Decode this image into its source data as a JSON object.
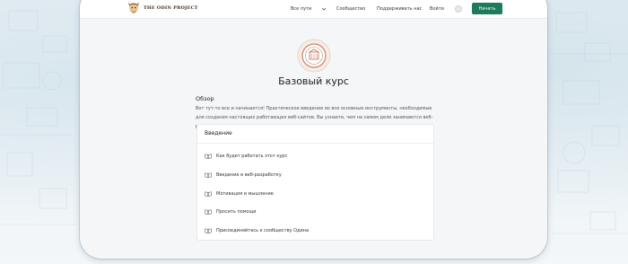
{
  "brand": {
    "name": "THE ODIN PROJECT"
  },
  "nav": {
    "items": [
      {
        "id": "paths",
        "label": "Все пути"
      },
      {
        "id": "community",
        "label": "Сообщество"
      },
      {
        "id": "support",
        "label": "Поддерживать нас"
      },
      {
        "id": "login",
        "label": "Войти"
      }
    ],
    "start_label": "Начать"
  },
  "course": {
    "title": "Базовый курс",
    "badge_icon": "foundations-badge-icon",
    "overview_heading": "Обзор",
    "overview_text": "Вот тут-то все и начинается! Практическое введение во все основные инструменты, необходимые для создания настоящих работающих веб-сайтов. Вы узнаете, чем на самом деле занимаются веб-разработчики – основы, которые вам понадобятся для последующих курсов."
  },
  "lessons": {
    "section_title": "Введение",
    "items": [
      {
        "label": "Как будет работать этот курс"
      },
      {
        "label": "Введение в веб-разработку"
      },
      {
        "label": "Мотивация и мышление"
      },
      {
        "label": "Просить помощи"
      },
      {
        "label": "Присоединяйтесь к сообществу Одина"
      }
    ]
  },
  "colors": {
    "accent": "#1f7a5c",
    "page_bg": "#f5f6f7",
    "backdrop": "#e6eef3"
  },
  "icons": {
    "logo": "odin-logo-icon",
    "theme": "theme-toggle-icon",
    "lesson": "book-icon"
  }
}
